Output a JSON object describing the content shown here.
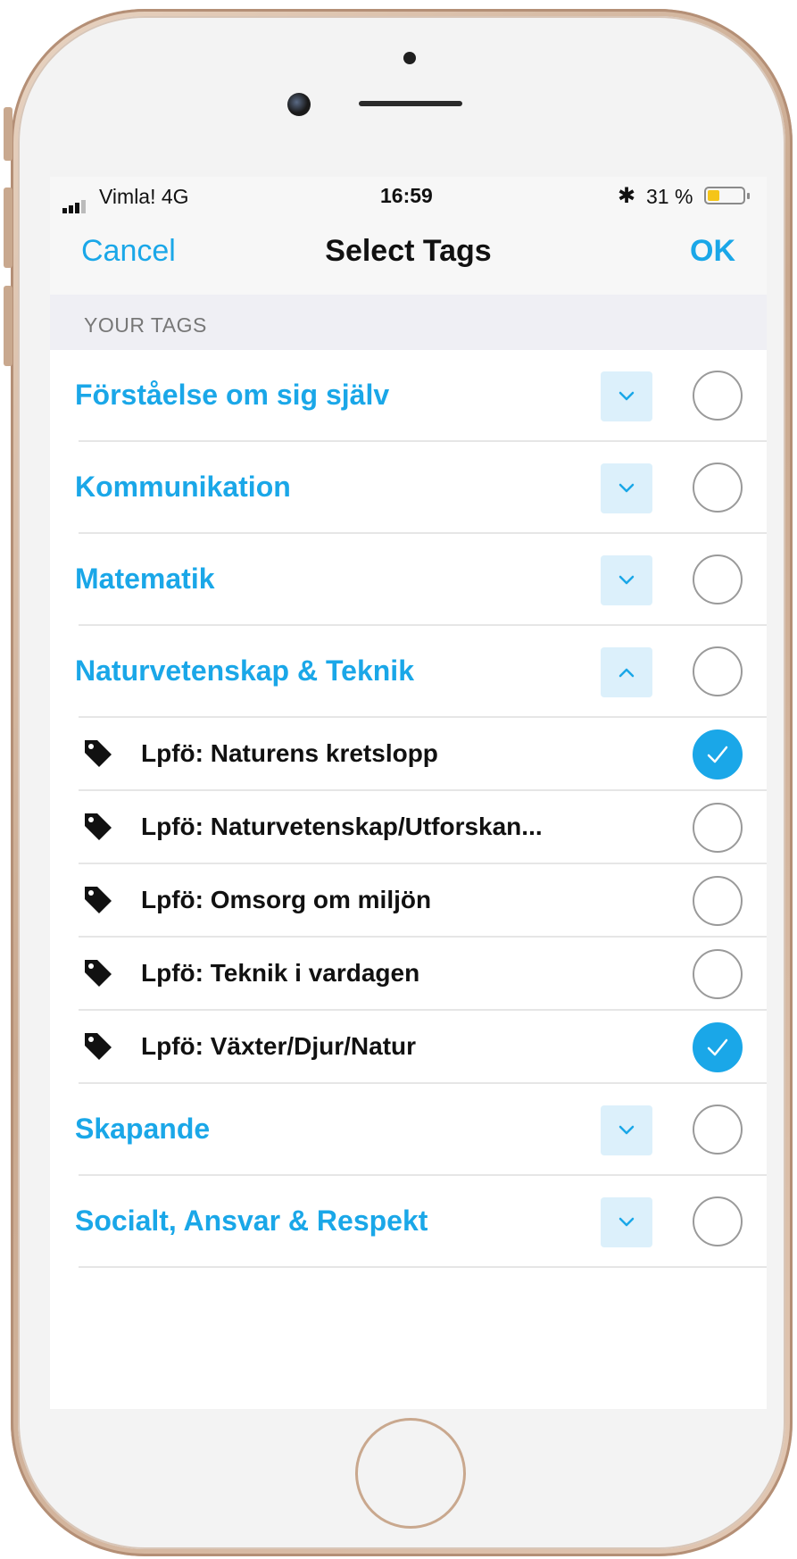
{
  "status_bar": {
    "carrier": "Vimla!  4G",
    "time": "16:59",
    "battery_text": "31 %",
    "bluetooth_symbol": "✱",
    "battery_color": "#f5c518"
  },
  "nav": {
    "cancel": "Cancel",
    "title": "Select Tags",
    "ok": "OK"
  },
  "section": {
    "header": "YOUR TAGS"
  },
  "accent_color": "#1aa7e8",
  "categories": [
    {
      "label": "Förståelse om sig själv",
      "expanded": false,
      "selected": false
    },
    {
      "label": "Kommunikation",
      "expanded": false,
      "selected": false
    },
    {
      "label": "Matematik",
      "expanded": false,
      "selected": false
    },
    {
      "label": "Naturvetenskap & Teknik",
      "expanded": true,
      "selected": false
    },
    {
      "label": "Skapande",
      "expanded": false,
      "selected": false
    },
    {
      "label": "Socialt, Ansvar & Respekt",
      "expanded": false,
      "selected": false
    }
  ],
  "subtags": [
    {
      "label": "Lpfö: Naturens kretslopp",
      "selected": true,
      "icon": "tag-icon"
    },
    {
      "label": "Lpfö: Naturvetenskap/Utforskan...",
      "selected": false,
      "icon": "tag-icon"
    },
    {
      "label": "Lpfö: Omsorg om miljön",
      "selected": false,
      "icon": "tag-icon"
    },
    {
      "label": "Lpfö: Teknik i vardagen",
      "selected": false,
      "icon": "tag-icon"
    },
    {
      "label": "Lpfö: Växter/Djur/Natur",
      "selected": true,
      "icon": "tag-icon"
    }
  ]
}
